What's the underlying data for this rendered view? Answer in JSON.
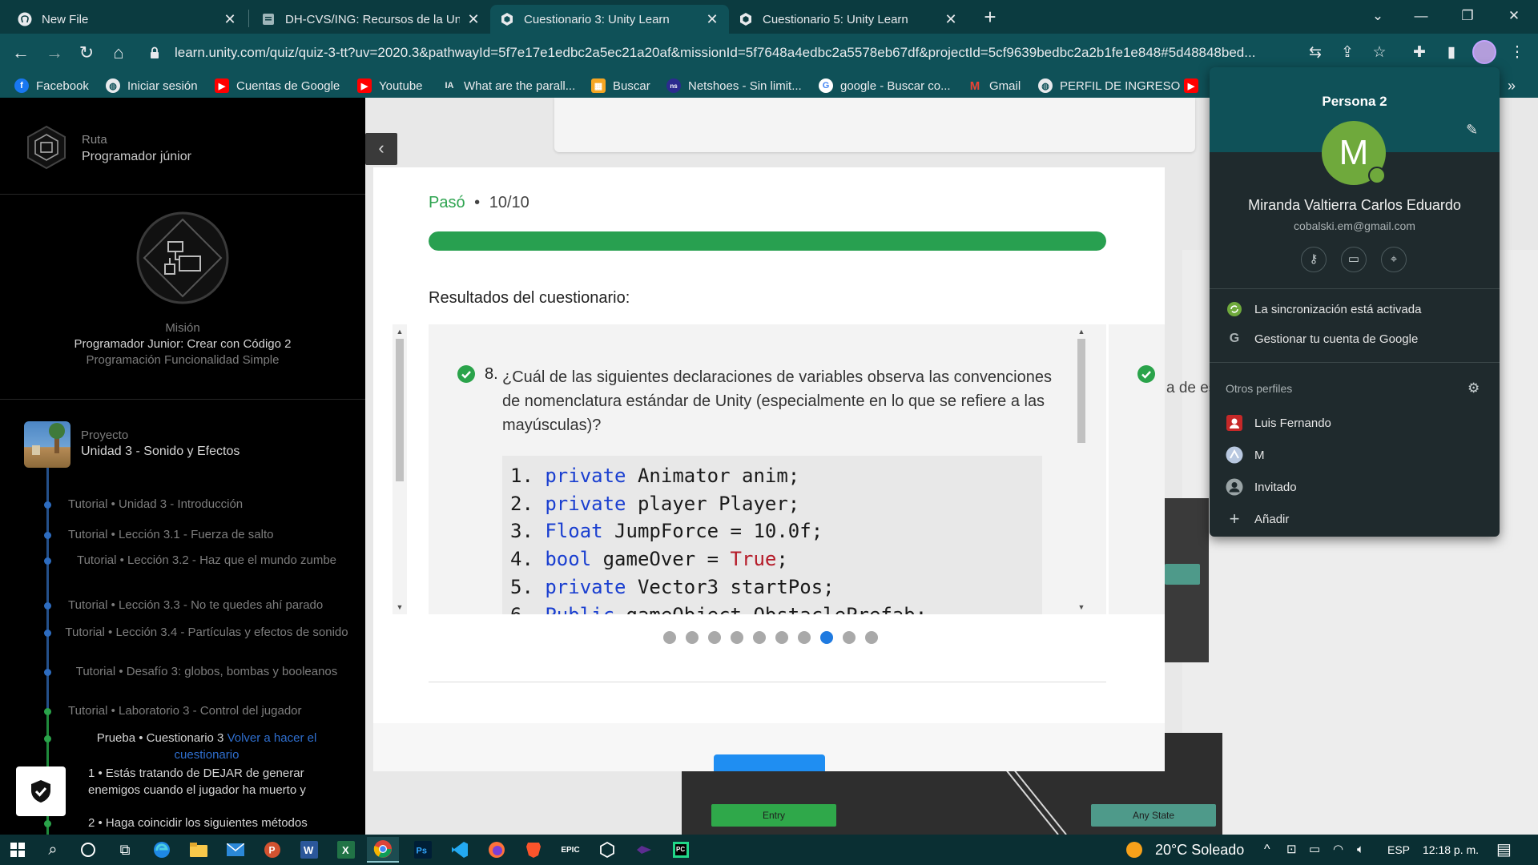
{
  "browser": {
    "tabs": [
      {
        "title": "New File",
        "icon": "github-icon"
      },
      {
        "title": "DH-CVS/ING: Recursos de la Unid",
        "icon": "doc-icon"
      },
      {
        "title": "Cuestionario 3: Unity Learn",
        "icon": "unity-icon",
        "active": true
      },
      {
        "title": "Cuestionario 5: Unity Learn",
        "icon": "unity-icon"
      }
    ],
    "url": "learn.unity.com/quiz/quiz-3-tt?uv=2020.3&pathwayId=5f7e17e1edbc2a5ec21a20af&missionId=5f7648a4edbc2a5578eb67df&projectId=5cf9639bedbc2a2b1fe1e848#5d48848bed...",
    "bookmarks": [
      {
        "label": "Facebook",
        "icon": "facebook-icon",
        "color": "#1877f2"
      },
      {
        "label": "Iniciar sesión",
        "icon": "globe-icon",
        "color": "#e8eaed"
      },
      {
        "label": "Cuentas de Google",
        "icon": "youtube-icon",
        "color": "#ff0000"
      },
      {
        "label": "Youtube",
        "icon": "youtube-icon",
        "color": "#ff0000"
      },
      {
        "label": "What are the parall...",
        "icon": "ia-icon",
        "color": "#e8eaed"
      },
      {
        "label": "Buscar",
        "icon": "bookmark-icon",
        "color": "#f5a623"
      },
      {
        "label": "Netshoes - Sin limit...",
        "icon": "netshoes-icon",
        "color": "#2b2b8f"
      },
      {
        "label": "google - Buscar co...",
        "icon": "google-icon",
        "color": "#ffffff"
      },
      {
        "label": "Gmail",
        "icon": "gmail-icon",
        "color": "#ea4335"
      },
      {
        "label": "PERFIL DE INGRESO",
        "icon": "globe-icon",
        "color": "#e8eaed"
      }
    ]
  },
  "sidebar": {
    "route_label": "Ruta",
    "route_value": "Programador júnior",
    "mission_label": "Misión",
    "mission_title": "Programador Junior: Crear con Código 2",
    "mission_subtitle": "Programación Funcionalidad Simple",
    "project_label": "Proyecto",
    "project_title": "Unidad 3 - Sonido y Efectos",
    "items": [
      {
        "text": "Tutorial • Unidad 3 - Introducción"
      },
      {
        "text": "Tutorial • Lección 3.1 - Fuerza de salto"
      },
      {
        "text": "Tutorial • Lección 3.2 - Haz que el mundo zumbe"
      },
      {
        "text": "Tutorial • Lección 3.3 - No te quedes ahí parado"
      },
      {
        "text": "Tutorial • Lección 3.4 - Partículas y efectos de sonido"
      },
      {
        "text": "Tutorial • Desafío 3: globos, bombas y booleanos"
      },
      {
        "text": "Tutorial • Laboratorio 3 - Control del jugador"
      }
    ],
    "current_item": "Prueba • Cuestionario 3",
    "redo_link": "Volver a hacer el cuestionario",
    "sub_items": [
      {
        "text": "1 • Estás tratando de DEJAR de generar enemigos cuando el jugador ha muerto y"
      },
      {
        "text": "2 • Haga coincidir los siguientes métodos"
      }
    ]
  },
  "background": {
    "partial_text": "a de es",
    "state_entry": "Entry",
    "state_any": "Any State"
  },
  "quiz": {
    "pass_label": "Pasó",
    "separator": "•",
    "score": "10/10",
    "progress": 1.0,
    "results_title": "Resultados del cuestionario:",
    "question_number": "8.",
    "question_text": "¿Cuál de las siguientes declaraciones de variables observa las convenciones de nomenclatura estándar de Unity (especialmente en lo que se refiere a las mayúsculas)?",
    "code_lines": [
      {
        "num": "1. ",
        "kw": "private",
        "rest": " Animator anim;"
      },
      {
        "num": "2. ",
        "kw": "private",
        "rest": " player Player;"
      },
      {
        "num": "3. ",
        "kw": "Float",
        "rest": " JumpForce = 10.0f;"
      },
      {
        "num": "4. ",
        "kw": "bool",
        "rest": " gameOver = ",
        "bool": "True",
        "tail": ";"
      },
      {
        "num": "5. ",
        "kw": "private",
        "rest": " Vector3 startPos;"
      },
      {
        "num": "6. ",
        "kw": "Public",
        "rest": " gameObject ObstaclePrefab;"
      }
    ],
    "pagination_total": 10,
    "pagination_active": 8
  },
  "profile_popup": {
    "title": "Persona 2",
    "avatar_letter": "M",
    "name": "Miranda Valtierra Carlos Eduardo",
    "email": "cobalski.em@gmail.com",
    "sync_label": "La sincronización está activada",
    "manage_label": "Gestionar tu cuenta de Google",
    "other_profiles_label": "Otros perfiles",
    "profiles": [
      {
        "label": "Luis Fernando",
        "icon": "person-icon"
      },
      {
        "label": "M",
        "icon": "avatar-icon"
      },
      {
        "label": "Invitado",
        "icon": "guest-icon"
      }
    ],
    "add_label": "Añadir"
  },
  "taskbar": {
    "weather": "20°C  Soleado",
    "language": "ESP",
    "time": "12:18 p. m."
  },
  "colors": {
    "tabbar": "#0b3b40",
    "toolbar": "#0f5158",
    "pass_green": "#2ea450",
    "progress_green": "#28a050",
    "active_dot": "#1f7ae0",
    "keyword_blue": "#1a3fd0",
    "bool_red": "#b51a28"
  }
}
